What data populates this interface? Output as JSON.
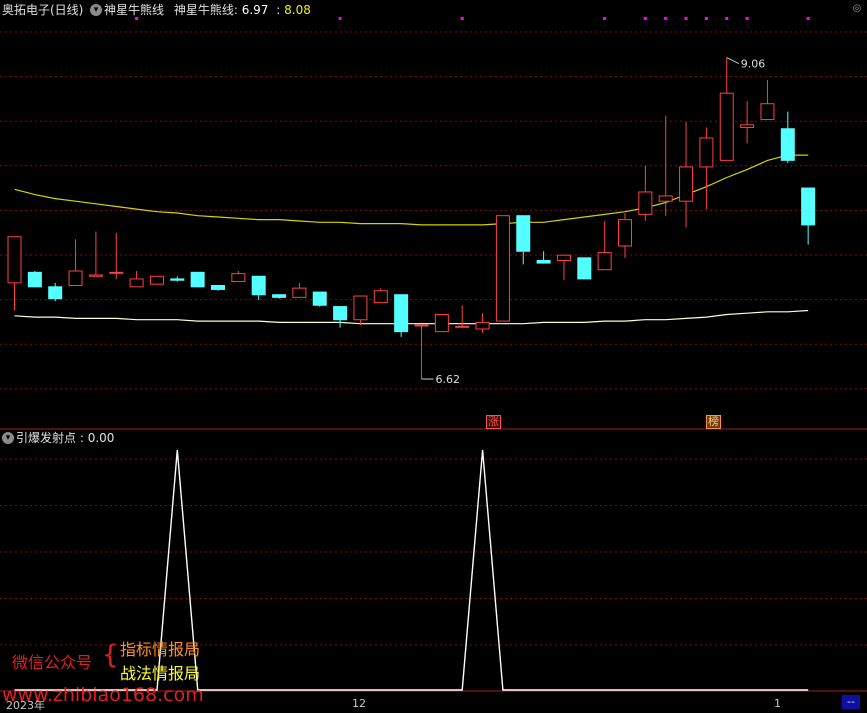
{
  "header": {
    "title": "奥拓电子(日线)",
    "indicator_name": "神星牛熊线",
    "series_label": "神星牛熊线:",
    "value1": "6.97",
    "sep": ":",
    "value2": "8.08"
  },
  "sub_header": {
    "label": "引爆发射点",
    "value": ": 0.00"
  },
  "annotations": {
    "high_label": "9.06",
    "low_label": "6.62",
    "tag_zhang": "涨",
    "tag_bang": "榜"
  },
  "watermark": {
    "left_text": "微信公众号",
    "brace": "{",
    "line1": "指标情报局",
    "line2": "战法情报局",
    "url": "www.zhibiao168.com"
  },
  "time_axis": {
    "year_label": "2023年",
    "month_12": "12",
    "month_1": "1",
    "corner": "--"
  },
  "colors": {
    "up": "#ff4040",
    "down": "#54ffff",
    "ma_long": "#ffffd0",
    "ma_mid": "#d4d400",
    "grid": "#7a1010",
    "signal": "#ffffff",
    "dots": "#ff00ff"
  },
  "chart_data": [
    {
      "type": "candlestick",
      "title": "奥拓电子(日线)",
      "ylim": [
        6.4,
        9.3
      ],
      "candles": [
        {
          "o": 7.35,
          "h": 7.58,
          "c": 7.7,
          "l": 7.14
        },
        {
          "o": 7.43,
          "h": 7.44,
          "c": 7.32,
          "l": 7.32
        },
        {
          "o": 7.32,
          "h": 7.35,
          "c": 7.23,
          "l": 7.21
        },
        {
          "o": 7.33,
          "h": 7.68,
          "c": 7.44,
          "l": 7.33
        },
        {
          "o": 7.4,
          "h": 7.74,
          "c": 7.41,
          "l": 7.4
        },
        {
          "o": 7.43,
          "h": 7.73,
          "c": 7.43,
          "l": 7.38
        },
        {
          "o": 7.32,
          "h": 7.44,
          "c": 7.38,
          "l": 7.32
        },
        {
          "o": 7.34,
          "h": 7.39,
          "c": 7.4,
          "l": 7.34
        },
        {
          "o": 7.38,
          "h": 7.4,
          "c": 7.37,
          "l": 7.36
        },
        {
          "o": 7.43,
          "h": 7.43,
          "c": 7.32,
          "l": 7.32
        },
        {
          "o": 7.33,
          "h": 7.33,
          "c": 7.3,
          "l": 7.29
        },
        {
          "o": 7.36,
          "h": 7.44,
          "c": 7.42,
          "l": 7.36
        },
        {
          "o": 7.4,
          "h": 7.4,
          "c": 7.26,
          "l": 7.22
        },
        {
          "o": 7.26,
          "h": 7.26,
          "c": 7.24,
          "l": 7.23
        },
        {
          "o": 7.24,
          "h": 7.35,
          "c": 7.31,
          "l": 7.24
        },
        {
          "o": 7.28,
          "h": 7.28,
          "c": 7.18,
          "l": 7.17
        },
        {
          "o": 7.17,
          "h": 7.17,
          "c": 7.07,
          "l": 7.01
        },
        {
          "o": 7.07,
          "h": 7.25,
          "c": 7.25,
          "l": 7.03
        },
        {
          "o": 7.2,
          "h": 7.31,
          "c": 7.29,
          "l": 7.2
        },
        {
          "o": 7.26,
          "h": 7.26,
          "c": 6.98,
          "l": 6.94
        },
        {
          "o": 7.03,
          "h": 7.03,
          "c": 7.03,
          "l": 6.62
        },
        {
          "o": 6.98,
          "h": 7.11,
          "c": 7.11,
          "l": 6.98
        },
        {
          "o": 7.02,
          "h": 7.18,
          "c": 7.02,
          "l": 7.02
        },
        {
          "o": 7.0,
          "h": 7.12,
          "c": 7.05,
          "l": 6.97
        },
        {
          "o": 7.06,
          "h": 7.86,
          "c": 7.86,
          "l": 7.06
        },
        {
          "o": 7.86,
          "h": 7.86,
          "c": 7.59,
          "l": 7.49
        },
        {
          "o": 7.52,
          "h": 7.59,
          "c": 7.5,
          "l": 7.5
        },
        {
          "o": 7.52,
          "h": 7.53,
          "c": 7.56,
          "l": 7.37
        },
        {
          "o": 7.54,
          "h": 7.54,
          "c": 7.38,
          "l": 7.38
        },
        {
          "o": 7.45,
          "h": 7.82,
          "c": 7.58,
          "l": 7.45
        },
        {
          "o": 7.63,
          "h": 7.88,
          "c": 7.83,
          "l": 7.54
        },
        {
          "o": 7.87,
          "h": 8.24,
          "c": 8.04,
          "l": 7.82
        },
        {
          "o": 7.97,
          "h": 8.62,
          "c": 8.01,
          "l": 7.86
        },
        {
          "o": 7.97,
          "h": 8.57,
          "c": 8.23,
          "l": 7.77
        },
        {
          "o": 8.23,
          "h": 8.53,
          "c": 8.45,
          "l": 7.91
        },
        {
          "o": 8.28,
          "h": 9.06,
          "c": 8.79,
          "l": 8.28
        },
        {
          "o": 8.53,
          "h": 8.73,
          "c": 8.55,
          "l": 8.41
        },
        {
          "o": 8.59,
          "h": 8.89,
          "c": 8.71,
          "l": 8.59
        },
        {
          "o": 8.52,
          "h": 8.65,
          "c": 8.28,
          "l": 8.26
        },
        {
          "o": 8.07,
          "h": 8.07,
          "c": 7.79,
          "l": 7.64
        }
      ],
      "series": [
        {
          "name": "神星牛熊线",
          "values": [
            8.06,
            8.02,
            7.99,
            7.97,
            7.95,
            7.93,
            7.91,
            7.89,
            7.88,
            7.86,
            7.85,
            7.84,
            7.83,
            7.83,
            7.82,
            7.81,
            7.81,
            7.8,
            7.8,
            7.8,
            7.79,
            7.79,
            7.79,
            7.79,
            7.8,
            7.81,
            7.81,
            7.83,
            7.85,
            7.87,
            7.89,
            7.92,
            7.96,
            8.02,
            8.08,
            8.15,
            8.21,
            8.28,
            8.32,
            8.32
          ]
        },
        {
          "name": "long_ma",
          "values": [
            7.1,
            7.09,
            7.09,
            7.08,
            7.08,
            7.08,
            7.07,
            7.07,
            7.07,
            7.06,
            7.06,
            7.06,
            7.06,
            7.05,
            7.05,
            7.05,
            7.05,
            7.04,
            7.04,
            7.04,
            7.04,
            7.04,
            7.04,
            7.04,
            7.04,
            7.04,
            7.05,
            7.05,
            7.05,
            7.06,
            7.06,
            7.07,
            7.07,
            7.08,
            7.09,
            7.11,
            7.12,
            7.13,
            7.13,
            7.14
          ]
        }
      ]
    },
    {
      "type": "line",
      "title": "引爆发射点",
      "ylim": [
        0,
        1
      ],
      "series": [
        {
          "name": "引爆发射点",
          "values": [
            0,
            0,
            0,
            0,
            0,
            0,
            0,
            0,
            1,
            0,
            0,
            0,
            0,
            0,
            0,
            0,
            0,
            0,
            0,
            0,
            0,
            0,
            0,
            1,
            0,
            0,
            0,
            0,
            0,
            0,
            0,
            0,
            0,
            0,
            0,
            0,
            0,
            0,
            0,
            0
          ]
        }
      ],
      "top_dots_at_index": [
        6,
        16,
        22,
        29,
        31,
        32,
        33,
        34,
        35,
        36,
        39
      ]
    }
  ]
}
